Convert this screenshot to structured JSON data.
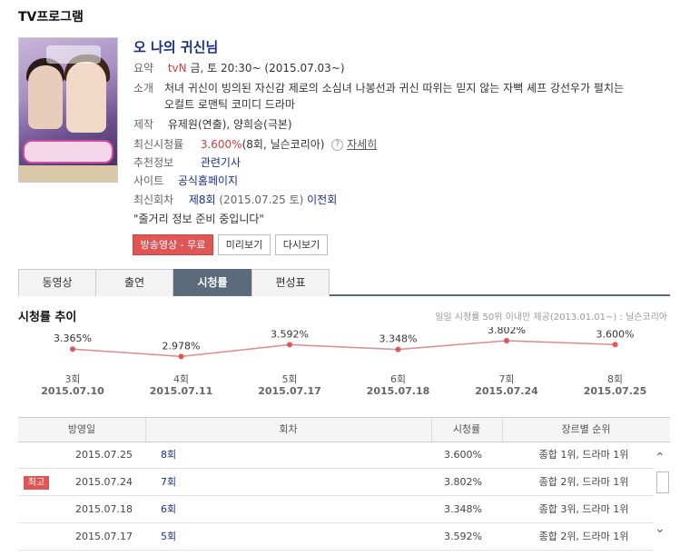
{
  "section_title": "TV프로그램",
  "show": {
    "title": "오 나의 귀신님",
    "summary_label": "요약",
    "channel": "tvN",
    "schedule": "금, 토 20:30~ (2015.07.03~)",
    "intro_label": "소개",
    "intro_line1": "처녀 귀신이 빙의된 자신감 제로의 소심녀 나봉선과 귀신 따위는 믿지 않는 자뻑 셰프 강선우가 펼치는",
    "intro_line2": "오컬트 로맨틱 코미디 드라마",
    "prod_label": "제작",
    "prod_value": "유제원(연출), 양희승(극본)",
    "rating_label": "최신시청률",
    "rating_value": "3.600%",
    "rating_suffix": "(8회, 닐슨코리아)",
    "help_symbol": "?",
    "rating_detail": "자세히",
    "rec_label": "추천정보",
    "rec_value": "관련기사",
    "site_label": "사이트",
    "site_value": "공식홈페이지",
    "latest_label": "최신회차",
    "latest_ep": "제8회",
    "latest_date": "(2015.07.25 토)",
    "prev_ep": "이전회",
    "synopsis": "\"줄거리 정보 준비 중입니다\""
  },
  "buttons": {
    "watch_free": "방송영상 - 무료",
    "preview": "미리보기",
    "replay": "다시보기"
  },
  "tabs": [
    "동영상",
    "출연",
    "시청률",
    "편성표"
  ],
  "active_tab": 2,
  "ratings_title": "시청률 추이",
  "ratings_note": "일일 시청률 50위 이내만 제공(2013.01.01~) : 닐슨코리아",
  "chart_data": {
    "type": "line",
    "categories": [
      "3회",
      "4회",
      "5회",
      "6회",
      "7회",
      "8회"
    ],
    "dates": [
      "2015.07.10",
      "2015.07.11",
      "2015.07.17",
      "2015.07.18",
      "2015.07.24",
      "2015.07.25"
    ],
    "value_labels": [
      "3.365%",
      "2.978%",
      "3.592%",
      "3.348%",
      "3.802%",
      "3.600%"
    ],
    "values": [
      3.365,
      2.978,
      3.592,
      3.348,
      3.802,
      3.6
    ],
    "ylim": [
      2.9,
      3.85
    ],
    "line_color": "#e08a8a",
    "point_color": "#e05555"
  },
  "table": {
    "headers": [
      "방영일",
      "회차",
      "시청률",
      "장르별 순위"
    ],
    "best_badge": "최고",
    "rows": [
      {
        "date": "2015.07.25",
        "ep": "8회",
        "rating": "3.600%",
        "rank": "종합 1위, 드라마 1위",
        "best": false
      },
      {
        "date": "2015.07.24",
        "ep": "7회",
        "rating": "3.802%",
        "rank": "종합 2위, 드라마 1위",
        "best": true
      },
      {
        "date": "2015.07.18",
        "ep": "6회",
        "rating": "3.348%",
        "rank": "종합 3위, 드라마 1위",
        "best": false
      },
      {
        "date": "2015.07.17",
        "ep": "5회",
        "rating": "3.592%",
        "rank": "종합 2위, 드라마 1위",
        "best": false
      }
    ]
  },
  "icons": {
    "scroll_up": "chevron-up-icon",
    "scroll_down": "chevron-down-icon"
  },
  "scroll_symbols": {
    "up": "⌃",
    "down": "⌄"
  }
}
